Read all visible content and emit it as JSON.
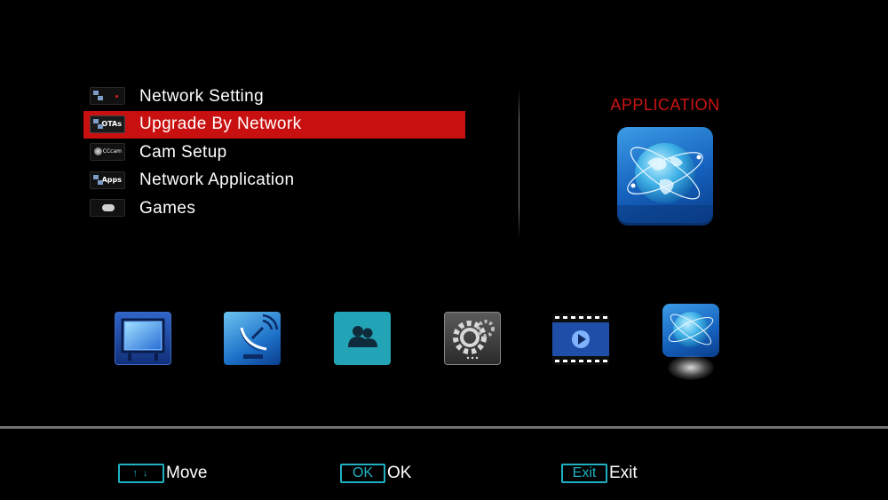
{
  "menu": {
    "items": [
      {
        "label": "Network Setting",
        "icon": "network-setting-icon",
        "tag": ""
      },
      {
        "label": "Upgrade By Network",
        "icon": "ota-icon",
        "tag": "OTAs",
        "selected": true
      },
      {
        "label": "Cam Setup",
        "icon": "cccam-icon",
        "tag": "CCcam"
      },
      {
        "label": "Network Application",
        "icon": "apps-icon",
        "tag": "Apps"
      },
      {
        "label": "Games",
        "icon": "gamepad-icon",
        "tag": ""
      }
    ],
    "selected_index": 1,
    "highlight_color": "#c91010"
  },
  "panel": {
    "title": "APPLICATION",
    "title_color": "#cc1414",
    "icon": "globe-icon"
  },
  "bottom_icons": [
    {
      "name": "tv-icon"
    },
    {
      "name": "satellite-dish-icon"
    },
    {
      "name": "users-icon"
    },
    {
      "name": "gear-icon"
    },
    {
      "name": "video-player-icon"
    },
    {
      "name": "globe-icon",
      "active": true
    }
  ],
  "hints": {
    "move": {
      "key": "↑↓",
      "label": "Move"
    },
    "ok": {
      "key": "OK",
      "label": "OK"
    },
    "exit": {
      "key": "Exit",
      "label": "Exit"
    },
    "key_color": "#1fb1c3"
  }
}
